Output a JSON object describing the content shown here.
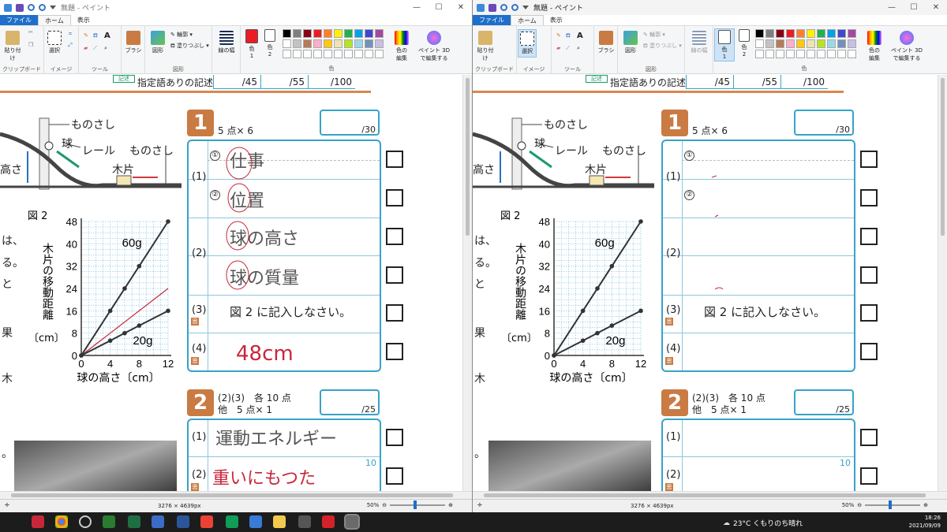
{
  "title": "無題 - ペイント",
  "win_controls": [
    "—",
    "☐",
    "✕"
  ],
  "menu": {
    "file": "ファイル",
    "home": "ホーム",
    "view": "表示"
  },
  "ribbon": {
    "clipboard": "クリップボード",
    "paste": "貼り付け",
    "image": "イメージ",
    "select": "選択",
    "tools": "ツール",
    "brush": "ブラシ",
    "shapes_group": "図形",
    "shapes": "図形",
    "outline": "輪郭",
    "fill": "塗りつぶし",
    "line_width": "線の幅",
    "color1": "色\n1",
    "color2": "色\n2",
    "colors": "色",
    "edit_colors": "色の\n編集",
    "paint3d": "ペイント 3D\nで編集する"
  },
  "palette": [
    "#000000",
    "#7f7f7f",
    "#880015",
    "#ed1c24",
    "#ff7f27",
    "#fff200",
    "#22b14c",
    "#00a2e8",
    "#3f48cc",
    "#a349a4",
    "#ffffff",
    "#c3c3c3",
    "#b97a57",
    "#ffaec9",
    "#ffc90e",
    "#efe4b0",
    "#b5e61d",
    "#99d9ea",
    "#7092be",
    "#c8bfe7"
  ],
  "color1_left": "#ed1c24",
  "color1_right": "#ffffff",
  "worksheet": {
    "top_note": "指定語ありの記述",
    "top_badge": "記述",
    "score_cells": [
      "/45",
      "/55",
      "/100"
    ],
    "sec1": "1",
    "sec1_points": "5 点× 6",
    "sec1_score": "/30",
    "sec2": "2",
    "sec2_points_a": "(2)(3)　各 10 点",
    "sec2_points_b": "他　5 点× 1",
    "sec2_score": "/25",
    "labels_diagram": {
      "rule1": "ものさし",
      "ball": "球",
      "rail": "レール",
      "rule2": "ものさし",
      "block": "木片",
      "height": "高さ"
    },
    "fig_label": "図 2",
    "side_text": [
      "は、",
      "る。",
      "と",
      "果",
      "木",
      "。"
    ],
    "r1": "(1)",
    "c1": "①",
    "c2": "②",
    "r2": "(2)",
    "r3": "(3)",
    "r3_text": "図 2 に記入しなさい。",
    "r4": "(4)",
    "kao": "思",
    "s2_r1": "(1)",
    "s2_r2": "(2)",
    "s2_num": "10"
  },
  "handwriting_left": {
    "a1": "仕事",
    "a2": "位置",
    "a3": "球の高さ",
    "a4": "球の質量",
    "a5": "48cm",
    "b1": "運動エネルギー",
    "b2": "重いにもつた"
  },
  "chart_data": {
    "type": "line",
    "xlabel": "球の高さ〔cm〕",
    "ylabel": "木片の移動距離",
    "yunit": "〔cm〕",
    "x_ticks": [
      0,
      4,
      8,
      12
    ],
    "y_ticks": [
      0,
      8,
      16,
      24,
      32,
      40,
      48
    ],
    "xlim": [
      0,
      12
    ],
    "ylim": [
      0,
      48
    ],
    "series": [
      {
        "name": "60g",
        "x": [
          0,
          4,
          6,
          8,
          12
        ],
        "y": [
          0,
          16,
          24,
          32,
          48
        ]
      },
      {
        "name": "20g",
        "x": [
          0,
          4,
          6,
          8,
          12
        ],
        "y": [
          0,
          5.3,
          8,
          10.7,
          16
        ]
      }
    ],
    "answer_line_left": {
      "x": [
        0,
        12
      ],
      "y": [
        0,
        24
      ],
      "color": "#c8273a"
    }
  },
  "status": {
    "dims": "3276 × 4639px",
    "zoom": "50%"
  },
  "taskbar": {
    "weather": "23°C くもりのち晴れ",
    "time": "18:26",
    "date": "2021/09/09"
  }
}
